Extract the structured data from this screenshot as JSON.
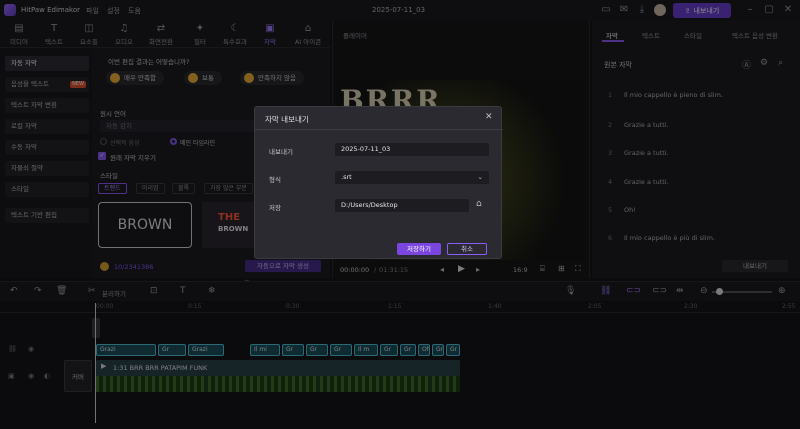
{
  "app": {
    "title": "HitPaw Edimakor",
    "menu": [
      "파일",
      "설정",
      "도움"
    ],
    "project_name": "2025-07-11_03",
    "export_label": "내보내기"
  },
  "toolbar": {
    "tools": [
      {
        "label": "미디어",
        "icon": "folder-icon"
      },
      {
        "label": "텍스트",
        "icon": "text-icon"
      },
      {
        "label": "요소들",
        "icon": "elements-icon"
      },
      {
        "label": "오디오",
        "icon": "music-icon"
      },
      {
        "label": "화면전환",
        "icon": "transition-icon"
      },
      {
        "label": "필터",
        "icon": "filter-icon"
      },
      {
        "label": "특수효과",
        "icon": "effects-icon"
      },
      {
        "label": "자막",
        "icon": "subtitle-icon"
      },
      {
        "label": "AI 아이콘",
        "icon": "ai-icon"
      }
    ]
  },
  "left_nav": {
    "items": [
      "자동 자막",
      "음성을 텍스트",
      "텍스트 자막 변환",
      "로컬 자막",
      "수동 자막",
      "자물쇠 절약",
      "스타일",
      "텍스트 기반 편집"
    ],
    "new_badge": "NEW"
  },
  "left_main": {
    "question": "이번 편집 결과는 어떻습니까?",
    "options": [
      "매우 만족함",
      "보통",
      "만족하지 않음"
    ],
    "source_lang_label": "원시 언어",
    "source_lang_value": "자동 감지",
    "radio_1": "선택적 음성",
    "radio_2": "메인 타임라인",
    "checkbox_label": "원래 자막 지우기",
    "style_label": "스타일",
    "style_tabs": [
      "트렌드",
      "미리엄",
      "블록",
      "가장 많은 부분"
    ],
    "card_1": "BROWN",
    "card_2_top": "THE",
    "card_2_bottom": "BROWN",
    "credits": "10/2341386",
    "generate_btn": "자동으로 자막 생성"
  },
  "player": {
    "label": "플레이어",
    "time_current": "00:00:00",
    "time_total": "01:31:15",
    "ratio": "16:9",
    "video_text": "BRRR"
  },
  "right_panel": {
    "tabs": [
      "자막",
      "텍스트",
      "스타일",
      "텍스트 음성 변환"
    ],
    "section_title": "원본 자막",
    "subtitles": [
      {
        "n": "1",
        "text": "Il mio cappello è pieno di slim."
      },
      {
        "n": "2",
        "text": "Grazie a tutti."
      },
      {
        "n": "3",
        "text": "Grazie a tutti."
      },
      {
        "n": "4",
        "text": "Grazie a tutti."
      },
      {
        "n": "5",
        "text": "Oh!"
      },
      {
        "n": "6",
        "text": "Il mio cappello è più di slim."
      }
    ],
    "export_btn": "내보내기"
  },
  "timeline": {
    "split_label": "분리하기",
    "ruler": [
      "00:00",
      "0:15",
      "0:30",
      "1:15",
      "1:40",
      "2:05",
      "2:30",
      "2:55"
    ],
    "cover_label": "커버",
    "clips": [
      "Grazi",
      "Gr",
      "Grazi",
      "Il mi",
      "Gr",
      "Gr",
      "Gr",
      "Il m",
      "Gr",
      "Gr",
      "Oh!",
      "Gr",
      "Gr"
    ],
    "audio_title": "1:31 BRR BRR PATAPIM FUNK"
  },
  "dialog": {
    "title": "자막 내보내기",
    "name_label": "내보내기",
    "name_value": "2025-07-11_03",
    "format_label": "형식",
    "format_value": ".srt",
    "save_label": "저장",
    "save_path": "D:/Users/Desktop",
    "primary_btn": "저장하기",
    "cancel_btn": "취소"
  }
}
